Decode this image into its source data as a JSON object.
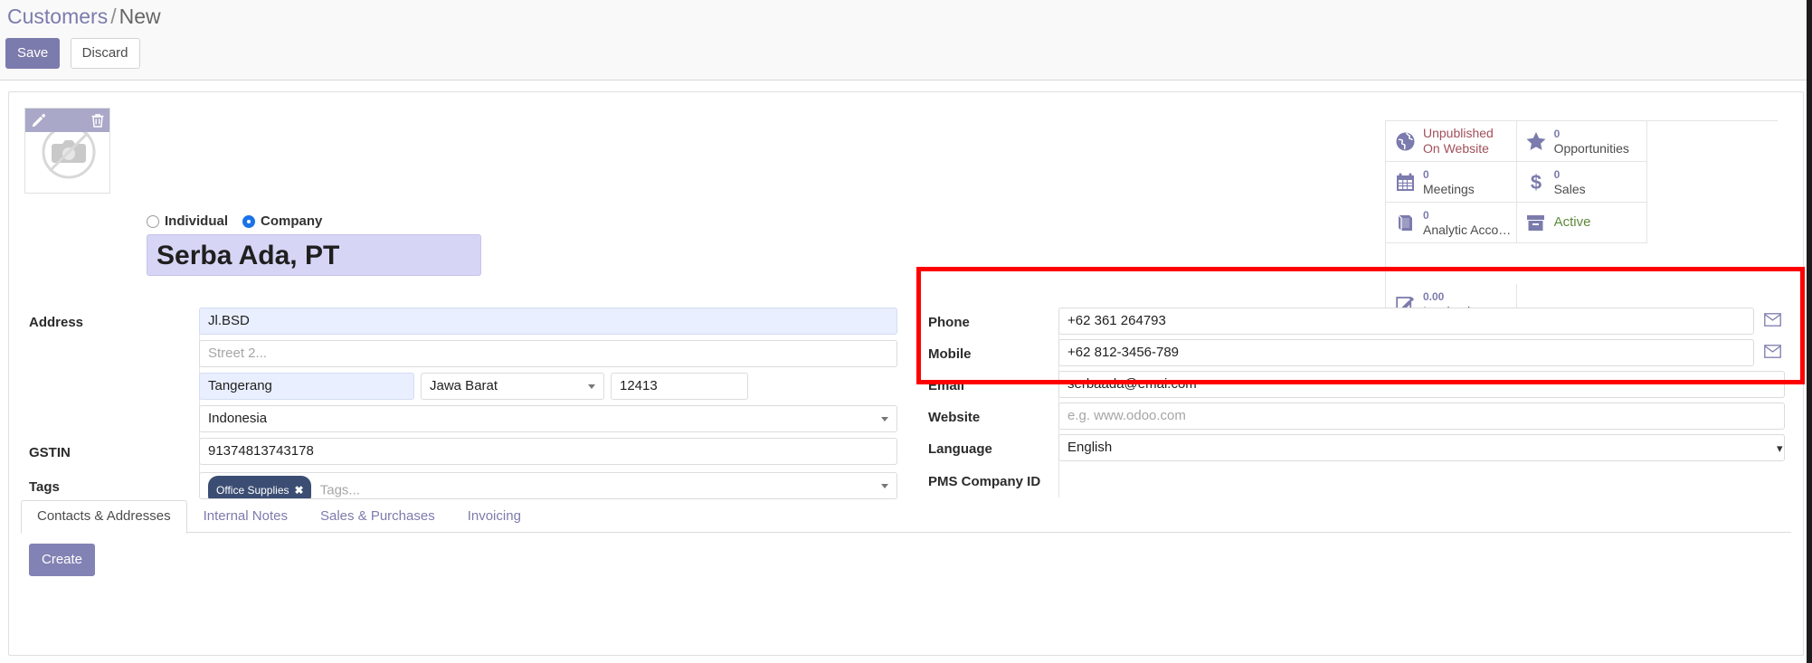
{
  "breadcrumb": {
    "root": "Customers",
    "separator": "/",
    "current": "New"
  },
  "actions": {
    "save_label": "Save",
    "discard_label": "Discard"
  },
  "avatar": {
    "edit_icon": "pencil-icon",
    "delete_icon": "trash-icon",
    "placeholder_icon": "no-camera-icon"
  },
  "partner_type": {
    "individual_label": "Individual",
    "company_label": "Company",
    "selected": "Company"
  },
  "record": {
    "name": "Serba Ada, PT"
  },
  "stat_buttons": [
    {
      "icon": "globe-icon",
      "value": "Unpublished",
      "label": "On Website",
      "style": "redish"
    },
    {
      "icon": "star-icon",
      "value": "0",
      "label": "Opportunities",
      "style": "normal"
    },
    {
      "icon": "calendar-icon",
      "value": "0",
      "label": "Meetings",
      "style": "normal"
    },
    {
      "icon": "dollar-icon",
      "value": "0",
      "label": "Sales",
      "style": "normal"
    },
    {
      "icon": "book-icon",
      "value": "0",
      "label": "Analytic Acco…",
      "style": "normal"
    },
    {
      "icon": "archive-icon",
      "value": "",
      "label": "Active",
      "style": "green"
    },
    {
      "icon": "pencil-square-icon",
      "value": "0.00",
      "label": "Invoiced",
      "style": "normal"
    }
  ],
  "form_left": {
    "address_label": "Address",
    "street": "Jl.BSD",
    "street2_placeholder": "Street 2...",
    "city": "Tangerang",
    "state": "Jawa Barat",
    "zip": "12413",
    "country": "Indonesia",
    "gstin_label": "GSTIN",
    "gstin": "91374813743178",
    "tags_label": "Tags",
    "tag_chip": "Office Supplies",
    "tag_chip_remove": "✖",
    "tags_placeholder": "Tags..."
  },
  "form_right": {
    "phone_label": "Phone",
    "phone": "+62 361 264793",
    "mobile_label": "Mobile",
    "mobile": "+62 812-3456-789",
    "email_label": "Email",
    "email": "serbaada@emai.com",
    "website_label": "Website",
    "website_placeholder": "e.g. www.odoo.com",
    "language_label": "Language",
    "language": "English",
    "pms_company_id_label": "PMS Company ID",
    "pms_company_id": "",
    "sms_icon": "envelope-icon"
  },
  "notebook": {
    "tabs": [
      {
        "label": "Contacts & Addresses",
        "active": true
      },
      {
        "label": "Internal Notes",
        "active": false
      },
      {
        "label": "Sales & Purchases",
        "active": false
      },
      {
        "label": "Invoicing",
        "active": false
      }
    ],
    "create_label": "Create"
  },
  "annotation": {
    "highlight_color": "#ff0000",
    "target": "phone-mobile-email-block"
  },
  "colors": {
    "accent": "#7c7bad",
    "save_button": "#7c7bad",
    "name_field_bg": "#d6d5f5",
    "focus_field_bg": "#e9efff",
    "chip_bg": "#3c4d73",
    "highlight": "#ff0000"
  }
}
